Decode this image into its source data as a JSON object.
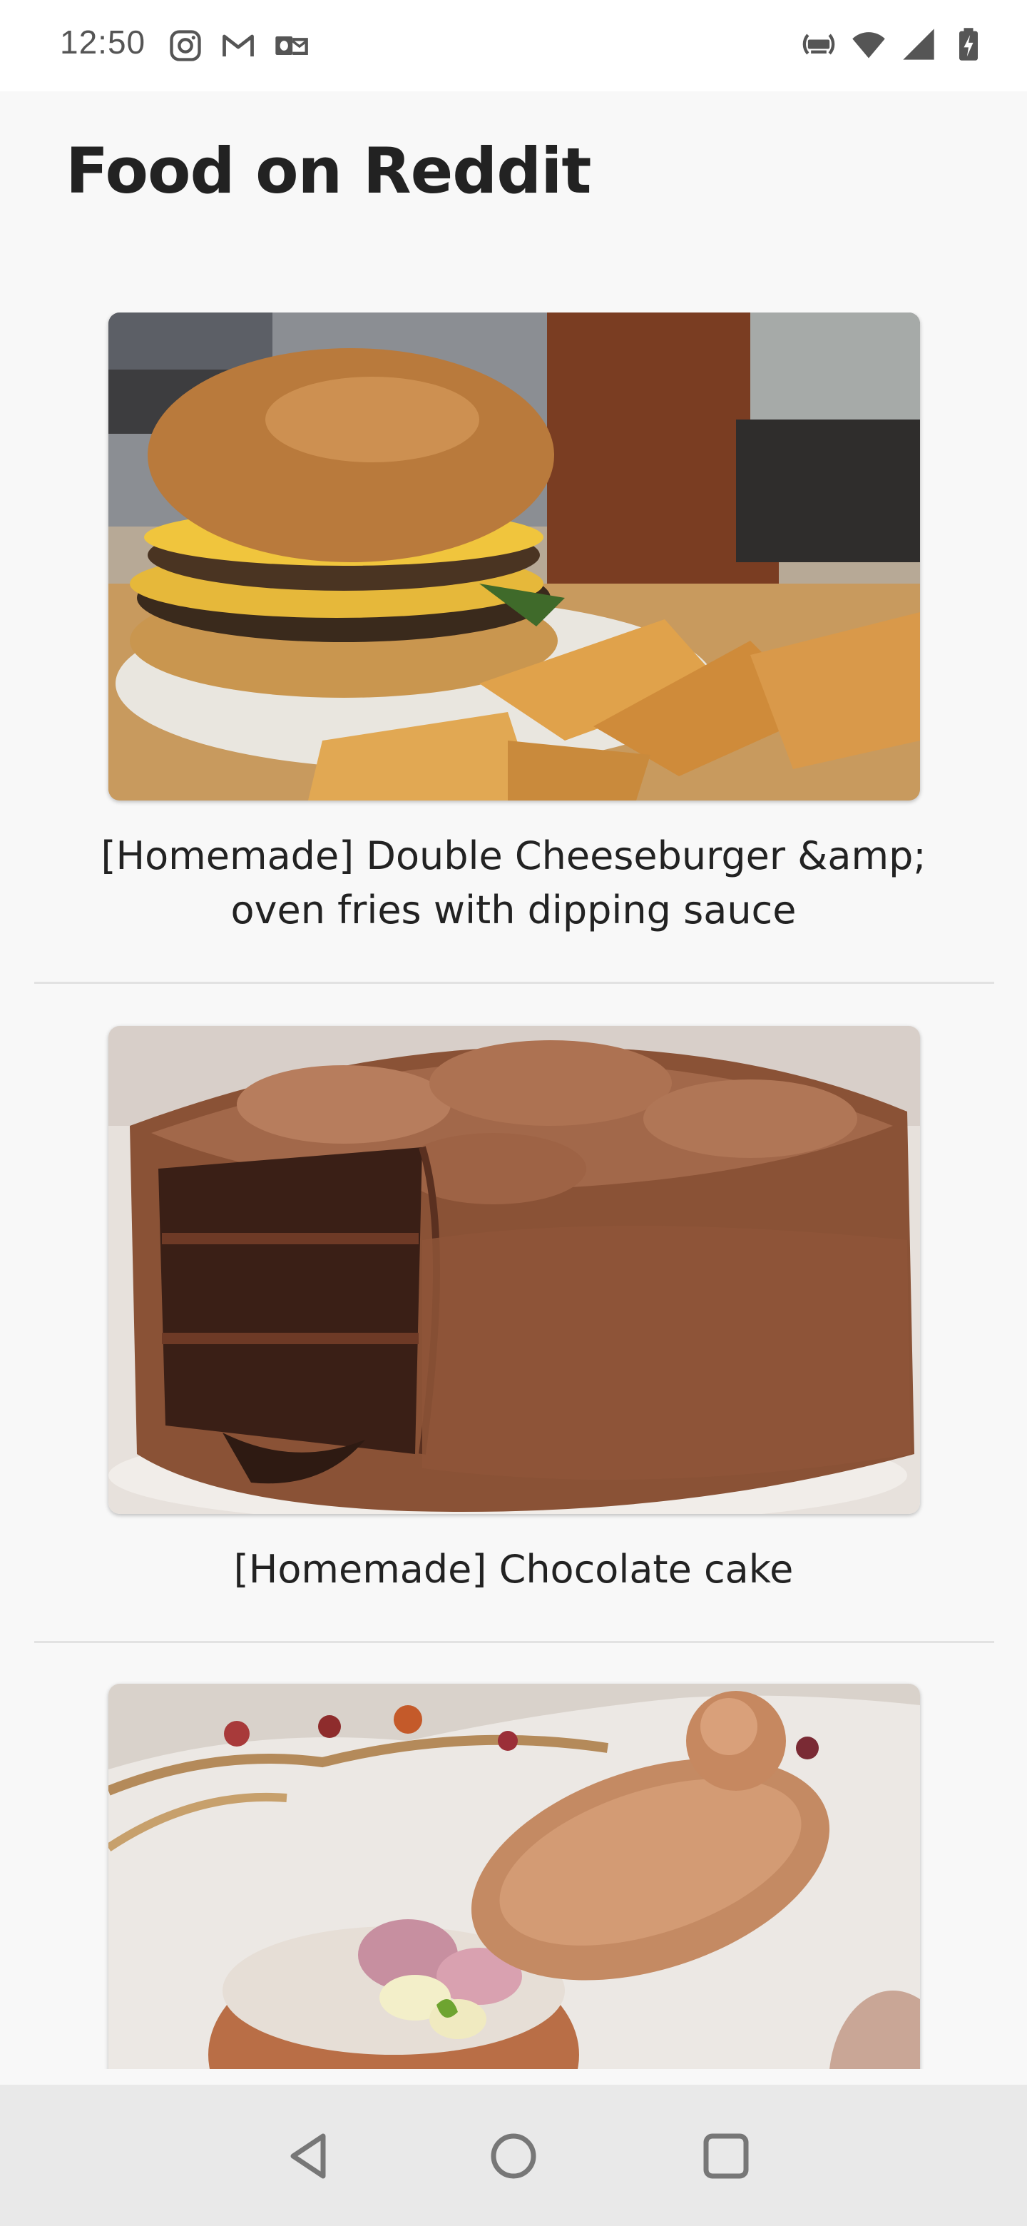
{
  "status_bar": {
    "time": "12:50",
    "left_icons": [
      "instagram-icon",
      "gmail-icon",
      "outlook-icon"
    ],
    "right_icons": [
      "volte-icon",
      "wifi-icon",
      "signal-icon",
      "battery-charging-icon"
    ]
  },
  "header": {
    "title": "Food on Reddit"
  },
  "posts": [
    {
      "title": "[Homemade] Double Cheeseburger &amp; oven fries with dipping sauce",
      "image": "cheeseburger-fries-photo"
    },
    {
      "title": "[Homemade] Chocolate cake",
      "image": "chocolate-cake-photo"
    },
    {
      "title": "",
      "image": "bread-bowl-soup-photo"
    }
  ],
  "nav_bar": {
    "buttons": [
      "back-icon",
      "home-icon",
      "recents-icon"
    ]
  }
}
